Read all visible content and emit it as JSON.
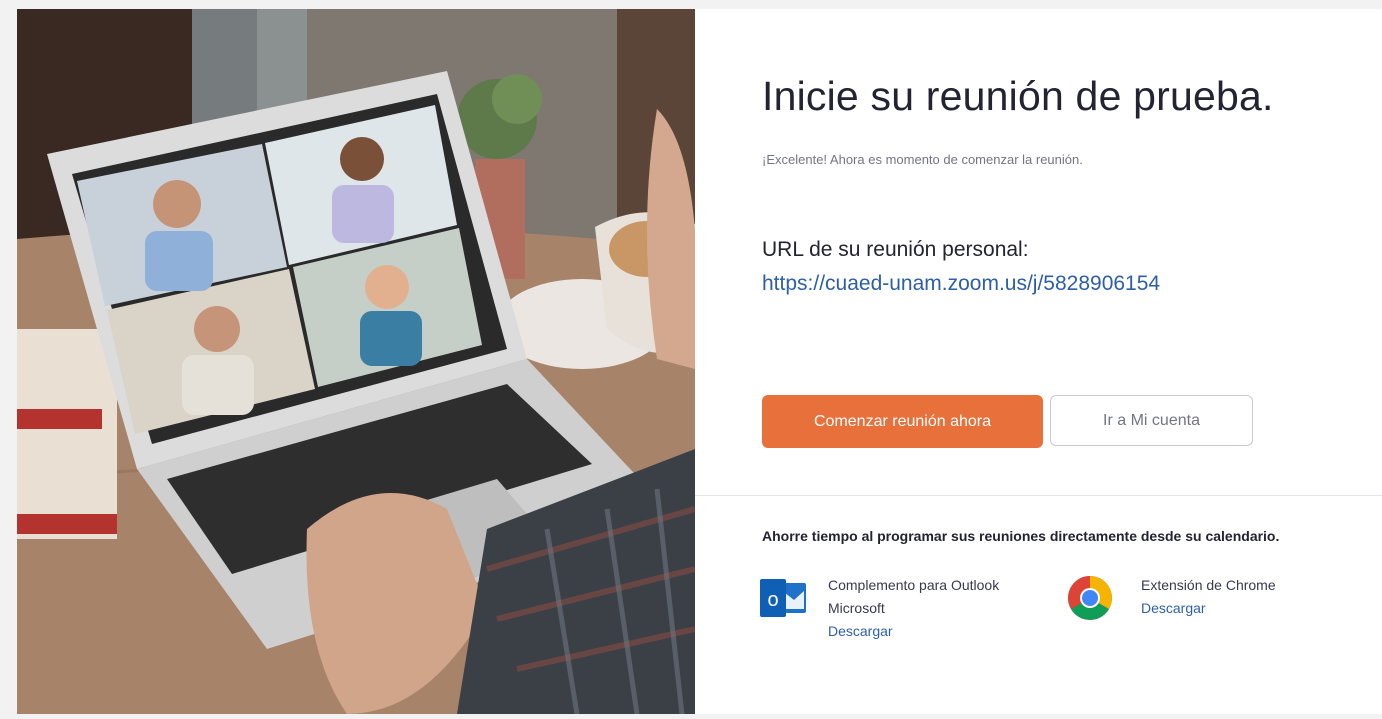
{
  "hero": {
    "alt": "Persona usando una laptop con videollamada de cuatro participantes"
  },
  "main": {
    "title": "Inicie su reunión de prueba.",
    "subtitle": "¡Excelente! Ahora es momento de comenzar la reunión.",
    "url_label": "URL de su reunión personal:",
    "url": "https://cuaed-unam.zoom.us/j/5828906154",
    "start_button": "Comenzar reunión ahora",
    "account_button": "Ir a Mi cuenta"
  },
  "calendar": {
    "note": "Ahorre tiempo al programar sus reuniones directamente desde su calendario.",
    "integrations": [
      {
        "name_line1": "Complemento para Outlook",
        "name_line2": "Microsoft",
        "link": "Descargar",
        "icon": "outlook-icon"
      },
      {
        "name_line1": "Extensión de Chrome",
        "name_line2": "",
        "link": "Descargar",
        "icon": "chrome-icon"
      }
    ]
  },
  "colors": {
    "accent": "#e8703a",
    "link": "#2d5fa8",
    "text": "#232333",
    "muted": "#747487"
  }
}
